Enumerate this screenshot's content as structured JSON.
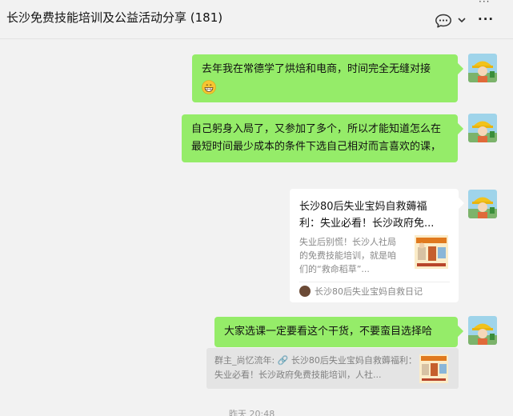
{
  "header": {
    "title": "长沙免费技能培训及公益活动分享 (181)",
    "chat_icon": "chat-bubble-icon",
    "chevron_icon": "chevron-down-icon",
    "more_icon": "more-icon",
    "more_glyph": "···"
  },
  "messages": [
    {
      "type": "text",
      "text": "去年我在常德学了烘焙和电商，时间完全无缝对接",
      "emoji": "grinning-face-emoji"
    },
    {
      "type": "text",
      "text": "自己躬身入局了，又参加了多个，所以才能知道怎么在最短时间最少成本的条件下选自己相对而言喜欢的课，",
      "emoji": ""
    },
    {
      "type": "link-card",
      "title": "长沙80后失业宝妈自救薅福利：失业必看！长沙政府免...",
      "desc": "失业后别慌！长沙人社局的免费技能培训，就是咱们的“救命稻草”...",
      "source": "长沙80后失业宝妈自救日记"
    },
    {
      "type": "text",
      "text": "大家选课一定要看这个干货，不要蛮目选择哈",
      "emoji": ""
    }
  ],
  "quote": {
    "text": "群主_尚忆流年: 🔗 长沙80后失业宝妈自救薅福利：失业必看！长沙政府免费技能培训，人社..."
  },
  "timestamp": "昨天 20:48",
  "colors": {
    "background": "#f2f2f2",
    "bubble_self": "#95ec69",
    "card": "#ffffff",
    "quote_bg": "#e4e4e4",
    "meta_text": "#999999"
  }
}
